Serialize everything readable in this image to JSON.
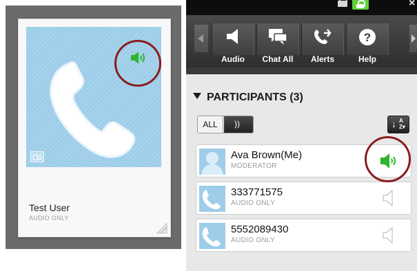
{
  "tile": {
    "name": "Test User",
    "status": "AUDIO ONLY",
    "speaker_icon": "speaker-active-icon"
  },
  "toolbar": {
    "buttons": [
      {
        "label": "Audio",
        "icon": "speaker-icon"
      },
      {
        "label": "Chat All",
        "icon": "chat-bubbles-icon"
      },
      {
        "label": "Alerts",
        "icon": "alert-phone-icon"
      },
      {
        "label": "Help",
        "icon": "question-icon"
      }
    ]
  },
  "participants": {
    "header": "PARTICIPANTS (3)",
    "filter_all": "ALL",
    "filter_audio": "))",
    "sort": {
      "arrow": "↓",
      "az": "A\nZ▾"
    },
    "list": [
      {
        "name": "Ava Brown(Me)",
        "role": "MODERATOR",
        "speaking": true
      },
      {
        "name": "333771575",
        "role": "AUDIO ONLY",
        "speaking": false
      },
      {
        "name": "5552089430",
        "role": "AUDIO ONLY",
        "speaking": false
      }
    ]
  },
  "colors": {
    "speaker_active": "#2fb52a",
    "highlight_ring": "#8b1c1c",
    "unlock_green": "#5fd23a"
  }
}
